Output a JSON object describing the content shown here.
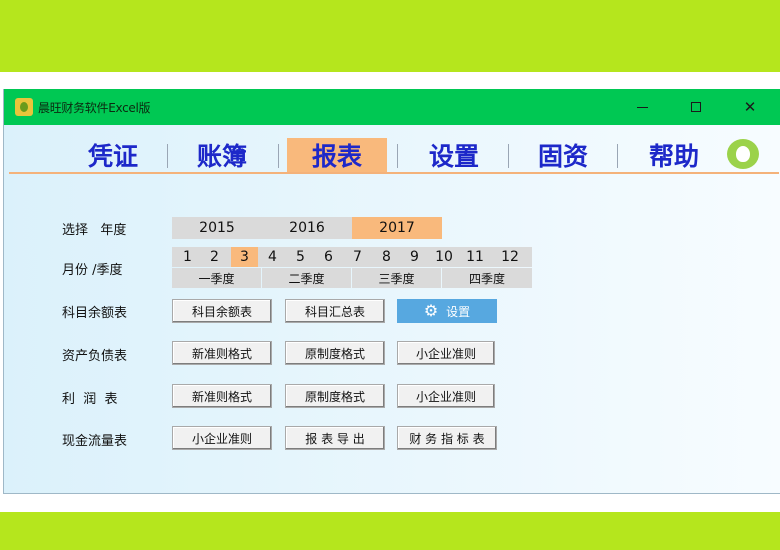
{
  "window": {
    "title": "晨旺财务软件Excel版"
  },
  "menu": [
    {
      "label": "凭证",
      "active": false
    },
    {
      "label": "账簿",
      "active": false
    },
    {
      "label": "报表",
      "active": true
    },
    {
      "label": "设置",
      "active": false
    },
    {
      "label": "固资",
      "active": false
    },
    {
      "label": "帮助",
      "active": false
    }
  ],
  "year_row": {
    "label": "选择   年度",
    "years": [
      "2015",
      "2016",
      "2017"
    ],
    "selected": "2017"
  },
  "month_row": {
    "label": "月份 /季度",
    "months": [
      "1",
      "2",
      "3",
      "4",
      "5",
      "6",
      "7",
      "8",
      "9",
      "10",
      "11",
      "12"
    ],
    "selected": "3",
    "quarters": [
      "一季度",
      "二季度",
      "三季度",
      "四季度"
    ]
  },
  "balance_row": {
    "label": "科目余额表",
    "buttons": [
      "科目余额表",
      "科目汇总表"
    ],
    "settings_label": "设置"
  },
  "balance_sheet_row": {
    "label": "资产负债表",
    "buttons": [
      "新准则格式",
      "原制度格式",
      "小企业准则"
    ]
  },
  "profit_row": {
    "label": "利  润  表",
    "buttons": [
      "新准则格式",
      "原制度格式",
      "小企业准则"
    ]
  },
  "cashflow_row": {
    "label": "现金流量表",
    "buttons": [
      "小企业准则",
      "报 表 导 出",
      "财 务 指 标 表"
    ]
  },
  "icons": {
    "app": "app-logo-icon",
    "gear": "gear-icon",
    "mascot": "rabbit-mascot-icon"
  },
  "colors": {
    "title_bar": "#00c853",
    "accent": "#f9b97c",
    "menu_text": "#1d28c9",
    "settings_button": "#57a8e0",
    "background": "#b5e61d"
  }
}
